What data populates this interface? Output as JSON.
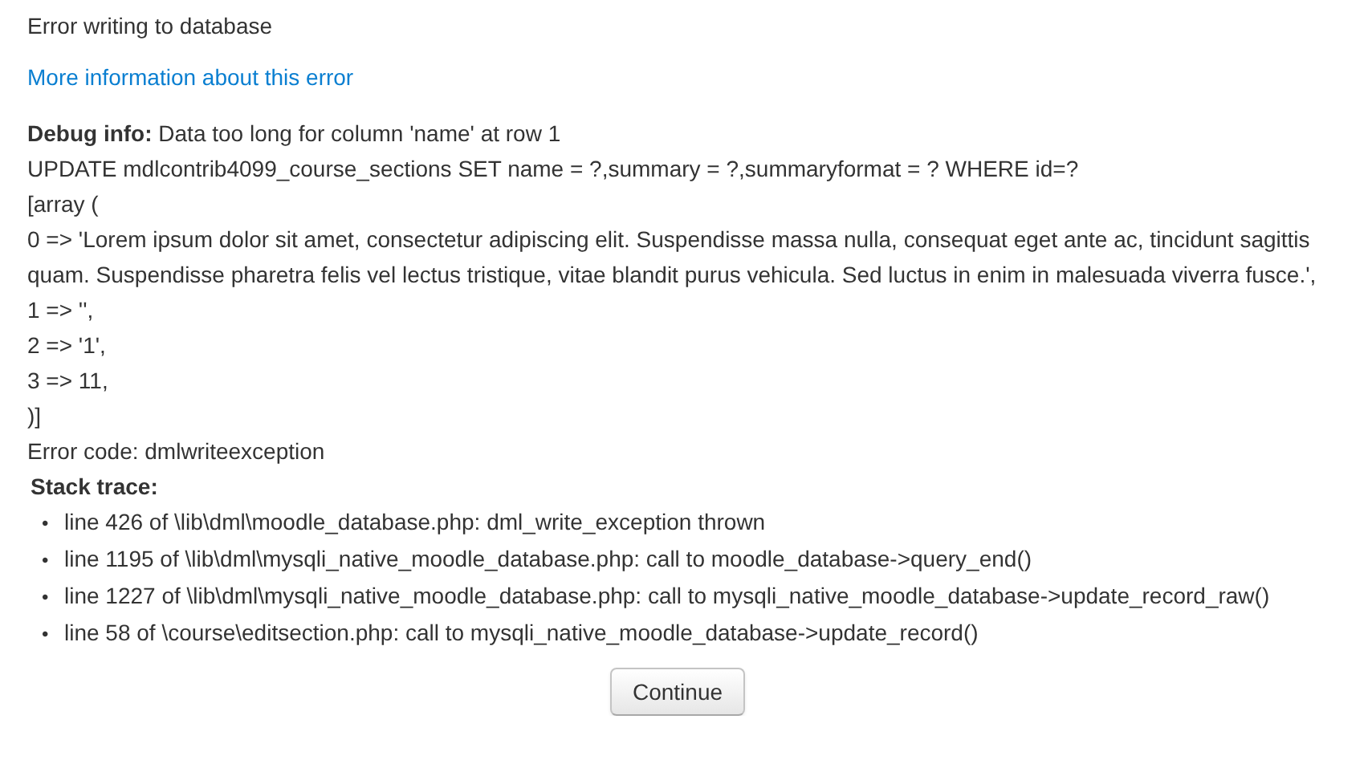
{
  "title": "Error writing to database",
  "more_info_link": "More information about this error",
  "debug": {
    "info": "**Debug info:** Data too long for column 'name' at row 1",
    "lines": [
      "UPDATE mdlcontrib4099_course_sections SET name = ?,summary = ?,summaryformat = ? WHERE id=?",
      "[array (",
      "0 => 'Lorem ipsum dolor sit amet, consectetur adipiscing elit. Suspendisse massa nulla, consequat eget ante ac, tincidunt sagittis quam. Suspendisse pharetra felis vel lectus tristique, vitae blandit purus vehicula. Sed luctus in enim in malesuada viverra fusce.',",
      "1 => '',",
      "2 => '1',",
      "3 => 11,",
      ")]",
      "Error code: dmlwriteexception"
    ]
  },
  "stack_trace": {
    "heading": "Stack trace:",
    "items": [
      {
        "bullet": "•",
        "text": "line 426 of \\lib\\dml\\moodle_database.php: dml_write_exception thrown"
      },
      {
        "bullet": "•",
        "text": "line 1195 of \\lib\\dml\\mysqli_native_moodle_database.php: call to moodle_database->query_end()"
      },
      {
        "bullet": "•",
        "text": "line 1227 of \\lib\\dml\\mysqli_native_moodle_database.php: call to mysqli_native_moodle_database->update_record_raw()"
      },
      {
        "bullet": "•",
        "text": "line 58 of \\course\\editsection.php: call to mysqli_native_moodle_database->update_record()"
      }
    ]
  },
  "button": "Continue"
}
